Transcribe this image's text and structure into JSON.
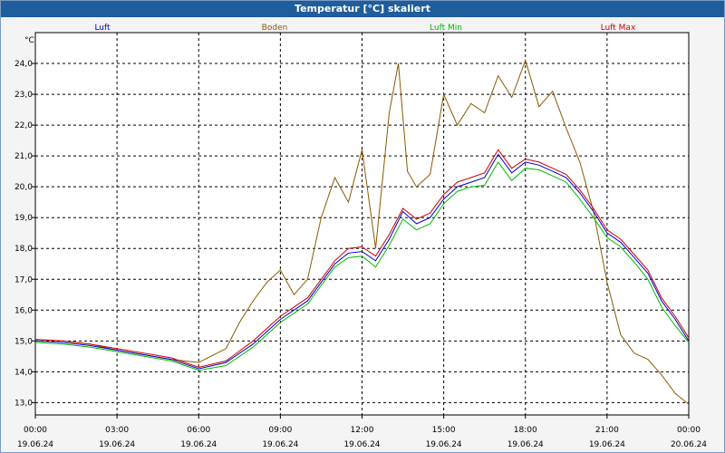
{
  "window": {
    "title": "Temperatur [°C] skaliert"
  },
  "chart_data": {
    "type": "line",
    "title": "Temperatur [°C] skaliert",
    "ylabel": "°C",
    "ylim": [
      12.6,
      25.0
    ],
    "yticks": [
      "13,0",
      "14,0",
      "15,0",
      "16,0",
      "17,0",
      "18,0",
      "19,0",
      "20,0",
      "21,0",
      "22,0",
      "23,0",
      "24,0"
    ],
    "xlim_hours": [
      0,
      24
    ],
    "xticks": [
      {
        "time": "00:00",
        "date": "19.06.24"
      },
      {
        "time": "03:00",
        "date": "19.06.24"
      },
      {
        "time": "06:00",
        "date": "19.06.24"
      },
      {
        "time": "09:00",
        "date": "19.06.24"
      },
      {
        "time": "12:00",
        "date": "19.06.24"
      },
      {
        "time": "15:00",
        "date": "19.06.24"
      },
      {
        "time": "18:00",
        "date": "19.06.24"
      },
      {
        "time": "21:00",
        "date": "19.06.24"
      },
      {
        "time": "00:00",
        "date": "20.06.24"
      }
    ],
    "grid": true,
    "legend_position": "top",
    "series": [
      {
        "name": "Luft",
        "color": "#0000cc",
        "x": [
          "00:00",
          "01:00",
          "02:00",
          "03:00",
          "04:00",
          "05:00",
          "06:00",
          "07:00",
          "08:00",
          "09:00",
          "10:00",
          "11:00",
          "11:30",
          "12:00",
          "12:30",
          "13:00",
          "13:30",
          "14:00",
          "14:30",
          "15:00",
          "15:30",
          "16:00",
          "16:30",
          "17:00",
          "17:30",
          "18:00",
          "18:30",
          "19:00",
          "19:30",
          "20:00",
          "20:30",
          "21:00",
          "21:30",
          "22:00",
          "22:30",
          "23:00",
          "23:30",
          "24:00"
        ],
        "y": [
          15.0,
          14.95,
          14.85,
          14.7,
          14.55,
          14.4,
          14.1,
          14.3,
          14.9,
          15.7,
          16.3,
          17.5,
          17.85,
          17.9,
          17.6,
          18.3,
          19.2,
          18.8,
          19.0,
          19.6,
          20.0,
          20.15,
          20.3,
          21.05,
          20.45,
          20.8,
          20.7,
          20.5,
          20.3,
          19.8,
          19.2,
          18.5,
          18.2,
          17.7,
          17.2,
          16.3,
          15.7,
          15.0
        ]
      },
      {
        "name": "Boden",
        "color": "#8b5a00",
        "x": [
          "00:00",
          "01:00",
          "02:00",
          "03:00",
          "04:00",
          "05:00",
          "06:00",
          "07:00",
          "07:30",
          "08:00",
          "08:30",
          "09:00",
          "09:30",
          "10:00",
          "10:30",
          "11:00",
          "11:30",
          "12:00",
          "12:30",
          "13:00",
          "13:20",
          "13:40",
          "14:00",
          "14:30",
          "15:00",
          "15:30",
          "16:00",
          "16:30",
          "17:00",
          "17:30",
          "18:00",
          "18:30",
          "19:00",
          "19:30",
          "20:00",
          "20:30",
          "21:00",
          "21:30",
          "22:00",
          "22:30",
          "23:00",
          "23:30",
          "24:00"
        ],
        "y": [
          15.05,
          15.0,
          14.9,
          14.7,
          14.55,
          14.4,
          14.3,
          14.75,
          15.6,
          16.3,
          16.9,
          17.3,
          16.5,
          17.0,
          19.0,
          20.3,
          19.5,
          21.2,
          18.0,
          22.4,
          24.0,
          20.5,
          20.0,
          20.4,
          23.0,
          22.0,
          22.7,
          22.4,
          23.6,
          22.9,
          24.1,
          22.6,
          23.1,
          21.9,
          20.8,
          19.2,
          16.9,
          15.2,
          14.6,
          14.4,
          13.9,
          13.3,
          12.95
        ]
      },
      {
        "name": "Luft Min",
        "color": "#00bb00",
        "x": [
          "00:00",
          "01:00",
          "02:00",
          "03:00",
          "04:00",
          "05:00",
          "06:00",
          "07:00",
          "08:00",
          "09:00",
          "10:00",
          "11:00",
          "11:30",
          "12:00",
          "12:30",
          "13:00",
          "13:30",
          "14:00",
          "14:30",
          "15:00",
          "15:30",
          "16:00",
          "16:30",
          "17:00",
          "17:30",
          "18:00",
          "18:30",
          "19:00",
          "19:30",
          "20:00",
          "20:30",
          "21:00",
          "21:30",
          "22:00",
          "22:30",
          "23:00",
          "23:30",
          "24:00"
        ],
        "y": [
          14.95,
          14.9,
          14.8,
          14.65,
          14.5,
          14.35,
          14.05,
          14.2,
          14.8,
          15.6,
          16.2,
          17.4,
          17.7,
          17.75,
          17.4,
          18.1,
          18.95,
          18.6,
          18.8,
          19.45,
          19.85,
          20.0,
          20.05,
          20.8,
          20.2,
          20.6,
          20.55,
          20.35,
          20.15,
          19.6,
          19.0,
          18.35,
          18.05,
          17.55,
          17.0,
          16.1,
          15.5,
          14.95
        ]
      },
      {
        "name": "Luft Max",
        "color": "#cc0000",
        "x": [
          "00:00",
          "01:00",
          "02:00",
          "03:00",
          "04:00",
          "05:00",
          "06:00",
          "07:00",
          "08:00",
          "09:00",
          "10:00",
          "11:00",
          "11:30",
          "12:00",
          "12:30",
          "13:00",
          "13:30",
          "14:00",
          "14:30",
          "15:00",
          "15:30",
          "16:00",
          "16:30",
          "17:00",
          "17:30",
          "18:00",
          "18:30",
          "19:00",
          "19:30",
          "20:00",
          "20:30",
          "21:00",
          "21:30",
          "22:00",
          "22:30",
          "23:00",
          "23:30",
          "24:00"
        ],
        "y": [
          15.05,
          15.0,
          14.9,
          14.75,
          14.6,
          14.45,
          14.15,
          14.35,
          15.0,
          15.8,
          16.4,
          17.6,
          18.0,
          18.05,
          17.75,
          18.45,
          19.3,
          18.95,
          19.15,
          19.75,
          20.15,
          20.3,
          20.45,
          21.2,
          20.6,
          20.9,
          20.8,
          20.6,
          20.4,
          19.9,
          19.3,
          18.6,
          18.3,
          17.8,
          17.3,
          16.4,
          15.8,
          15.1
        ]
      }
    ]
  }
}
